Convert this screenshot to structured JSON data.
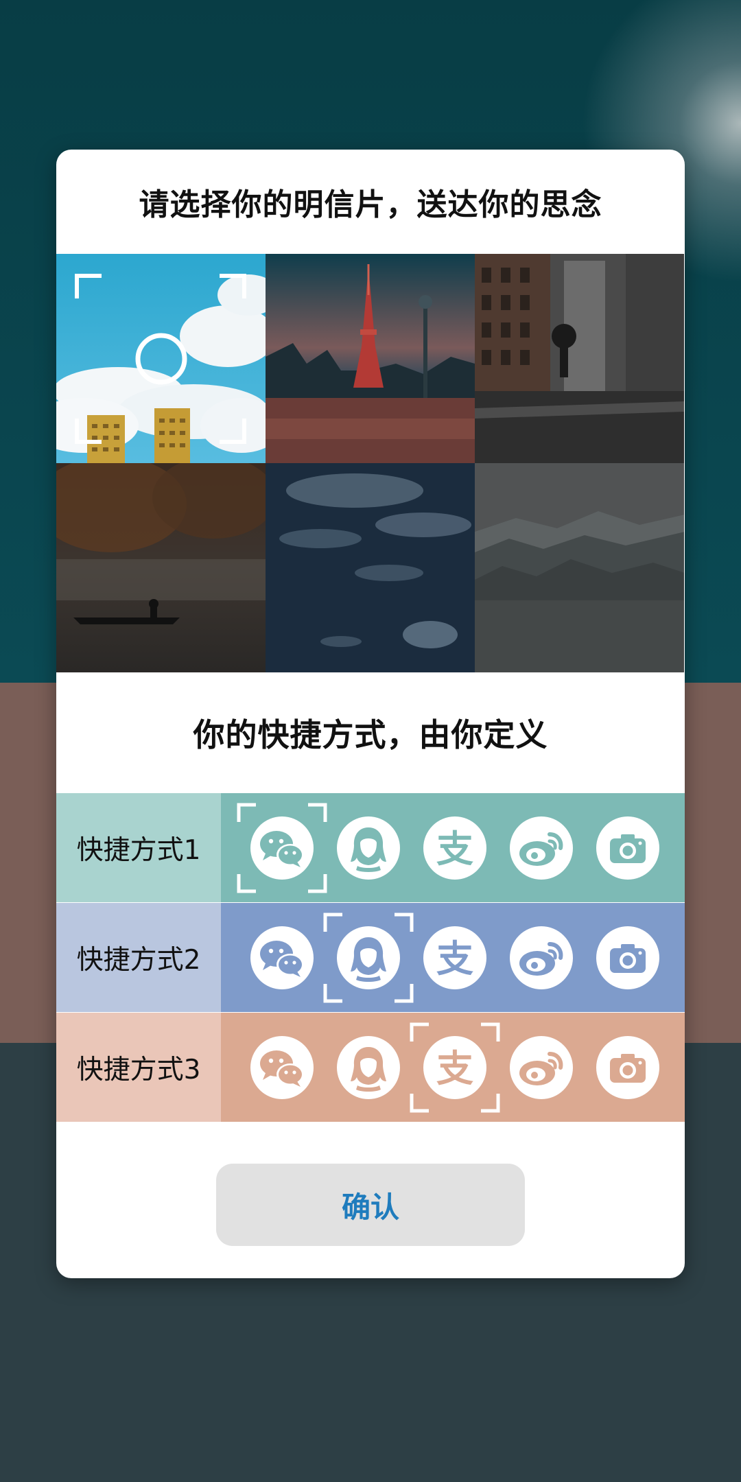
{
  "dialog": {
    "postcard_title": "请选择你的明信片，送达你的思念",
    "shortcut_title": "你的快捷方式，由你定义",
    "confirm_label": "确认"
  },
  "postcards": [
    {
      "name": "sky-buildings",
      "selected": true
    },
    {
      "name": "tokyo-tower-night",
      "selected": false
    },
    {
      "name": "rainy-street",
      "selected": false
    },
    {
      "name": "misty-lake-boat",
      "selected": false
    },
    {
      "name": "fish-water",
      "selected": false
    },
    {
      "name": "misty-mountains",
      "selected": false
    }
  ],
  "shortcuts": [
    {
      "label": "快捷方式1",
      "selected_icon": "wechat-icon",
      "label_bg": "#a9d3cf",
      "icons_bg": "#7dbab5"
    },
    {
      "label": "快捷方式2",
      "selected_icon": "qq-icon",
      "label_bg": "#b9c6df",
      "icons_bg": "#7f9bca"
    },
    {
      "label": "快捷方式3",
      "selected_icon": "alipay-icon",
      "label_bg": "#eac6b8",
      "icons_bg": "#dba991"
    }
  ],
  "icons": [
    "wechat-icon",
    "qq-icon",
    "alipay-icon",
    "weibo-icon",
    "camera-icon"
  ],
  "colors": {
    "accent": "#1f7cbd",
    "button_bg": "#e1e1e1"
  }
}
